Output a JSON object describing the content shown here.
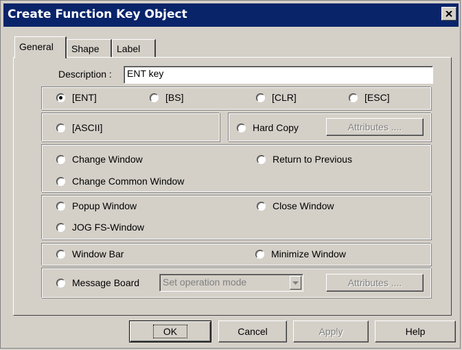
{
  "window": {
    "title": "Create Function Key  Object"
  },
  "tabs": [
    {
      "label": "General"
    },
    {
      "label": "Shape"
    },
    {
      "label": "Label"
    }
  ],
  "general": {
    "description_label": "Description :",
    "description_value": "ENT key",
    "keys": {
      "ent": "[ENT]",
      "bs": "[BS]",
      "clr": "[CLR]",
      "esc": "[ESC]",
      "selected": "[ENT]"
    },
    "ascii": "[ASCII]",
    "hard_copy": "Hard Copy",
    "hard_copy_attributes": "Attributes ....",
    "change_window": "Change Window",
    "return_to_previous": "Return to Previous",
    "change_common_window": "Change Common Window",
    "popup_window": "Popup Window",
    "close_window": "Close Window",
    "jog_fs_window": "JOG FS-Window",
    "window_bar": "Window Bar",
    "minimize_window": "Minimize Window",
    "message_board": "Message Board",
    "message_board_select": "Set operation mode",
    "message_board_attributes": "Attributes ...."
  },
  "buttons": {
    "ok": "OK",
    "cancel": "Cancel",
    "apply": "Apply",
    "help": "Help"
  }
}
